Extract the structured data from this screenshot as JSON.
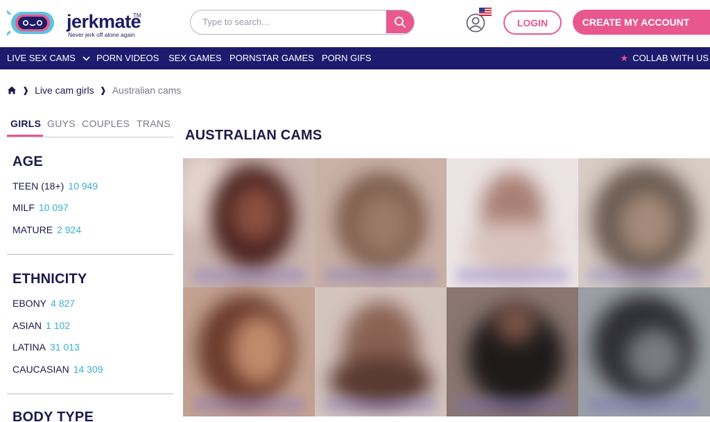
{
  "header": {
    "logo_word": "jerkmate",
    "logo_tm": "TM",
    "logo_tagline": "Never jerk off alone again",
    "search_placeholder": "Type to search...",
    "login_label": "LOGIN",
    "create_label": "CREATE MY ACCOUNT"
  },
  "nav": {
    "items": [
      "LIVE SEX CAMS",
      "PORN VIDEOS",
      "SEX GAMES",
      "PORNSTAR GAMES",
      "PORN GIFS"
    ],
    "collab_label": "COLLAB WITH US"
  },
  "breadcrumb": {
    "items": [
      "Live cam girls",
      "Australian cams"
    ]
  },
  "tabs": [
    "GIRLS",
    "GUYS",
    "COUPLES",
    "TRANS"
  ],
  "sidebar": {
    "age": {
      "title": "AGE",
      "items": [
        {
          "label": "TEEN (18+)",
          "count": "10 949"
        },
        {
          "label": "MILF",
          "count": "10 097"
        },
        {
          "label": "MATURE",
          "count": "2 924"
        }
      ]
    },
    "ethnicity": {
      "title": "ETHNICITY",
      "items": [
        {
          "label": "EBONY",
          "count": "4 827"
        },
        {
          "label": "ASIAN",
          "count": "1 102"
        },
        {
          "label": "LATINA",
          "count": "31 013"
        },
        {
          "label": "CAUCASIAN",
          "count": "14 309"
        }
      ]
    },
    "body_type": {
      "title": "BODY TYPE"
    }
  },
  "main": {
    "title": "AUSTRALIAN CAMS"
  },
  "colors": {
    "brand_pink": "#e8588f",
    "nav_navy": "#1d1b6e",
    "text_navy": "#1b1a4a",
    "count_blue": "#3aaecf"
  }
}
